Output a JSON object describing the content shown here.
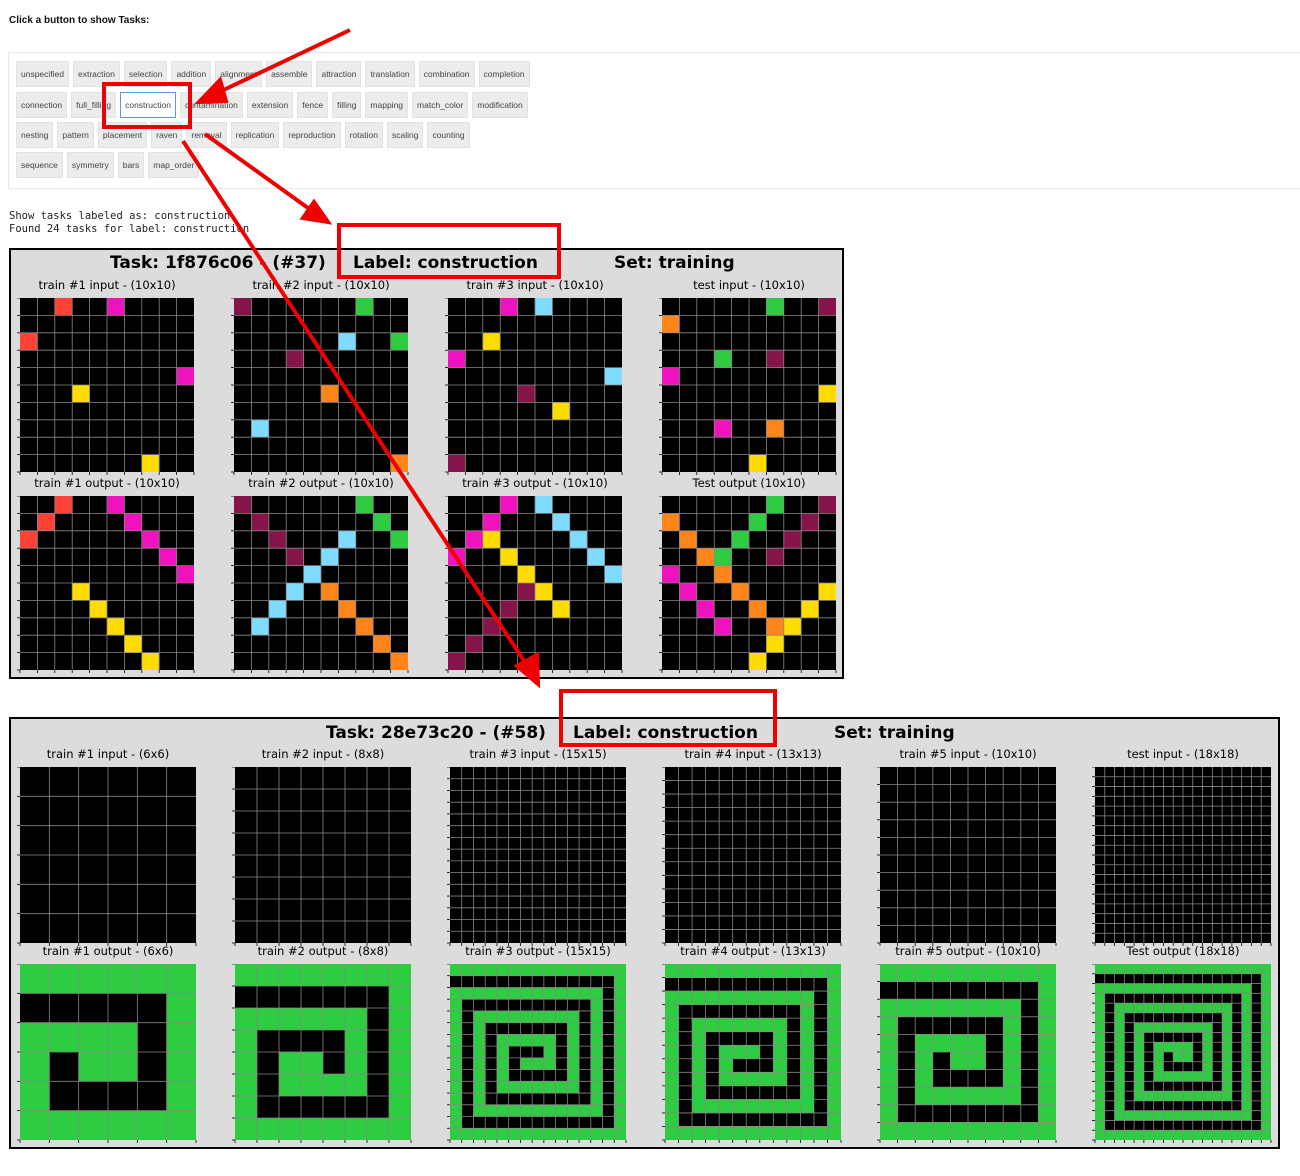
{
  "prompt": "Click a button to show Tasks:",
  "label_buttons": [
    [
      "unspecified",
      "extraction",
      "selection",
      "addition",
      "alignment",
      "assemble",
      "attraction",
      "translation",
      "combination",
      "completion"
    ],
    [
      "connection",
      "full_filling",
      "construction",
      "contamination",
      "extension",
      "fence",
      "filling",
      "mapping",
      "match_color",
      "modification"
    ],
    [
      "nesting",
      "pattern",
      "placement",
      "raven",
      "removal",
      "replication",
      "reproduction",
      "rotation",
      "scaling",
      "counting"
    ],
    [
      "sequence",
      "symmetry",
      "bars",
      "map_order"
    ]
  ],
  "selected_label": "construction",
  "output_lines": [
    "Show tasks labeled as: construction",
    "Found 24 tasks for label: construction"
  ],
  "colors": {
    "black": "#000000",
    "red": "#ff4136",
    "magenta": "#f012be",
    "green": "#2ecc40",
    "yellow": "#ffdc00",
    "orange": "#ff851b",
    "sky": "#7fdbff",
    "maroon": "#85144b",
    "figure_bg": "#dcdcdc",
    "annotation": "#ee0000",
    "grid_line": "#888888"
  },
  "tasks": [
    {
      "title_task": "Task: 1f876c06 - (#37)",
      "title_label": "Label: construction",
      "title_set": "Set: training",
      "panels": [
        {
          "title": "train #1 input  - (10x10)",
          "size": 10,
          "cells": [
            [
              0,
              2,
              "red"
            ],
            [
              0,
              5,
              "magenta"
            ],
            [
              2,
              0,
              "red"
            ],
            [
              4,
              9,
              "magenta"
            ],
            [
              5,
              3,
              "yellow"
            ],
            [
              9,
              7,
              "yellow"
            ]
          ]
        },
        {
          "title": "train #2 input  - (10x10)",
          "size": 10,
          "cells": [
            [
              0,
              0,
              "maroon"
            ],
            [
              0,
              7,
              "green"
            ],
            [
              2,
              6,
              "sky"
            ],
            [
              2,
              9,
              "green"
            ],
            [
              3,
              3,
              "maroon"
            ],
            [
              5,
              5,
              "orange"
            ],
            [
              7,
              1,
              "sky"
            ],
            [
              9,
              9,
              "orange"
            ]
          ]
        },
        {
          "title": "train #3 input  - (10x10)",
          "size": 10,
          "cells": [
            [
              0,
              3,
              "magenta"
            ],
            [
              0,
              5,
              "sky"
            ],
            [
              2,
              2,
              "yellow"
            ],
            [
              3,
              0,
              "magenta"
            ],
            [
              4,
              9,
              "sky"
            ],
            [
              5,
              4,
              "maroon"
            ],
            [
              6,
              6,
              "yellow"
            ],
            [
              9,
              0,
              "maroon"
            ]
          ]
        },
        {
          "title": "test input  - (10x10)",
          "size": 10,
          "cells": [
            [
              0,
              6,
              "green"
            ],
            [
              0,
              9,
              "maroon"
            ],
            [
              1,
              0,
              "orange"
            ],
            [
              3,
              3,
              "green"
            ],
            [
              3,
              6,
              "maroon"
            ],
            [
              4,
              0,
              "magenta"
            ],
            [
              5,
              9,
              "yellow"
            ],
            [
              7,
              3,
              "magenta"
            ],
            [
              7,
              6,
              "orange"
            ],
            [
              9,
              5,
              "yellow"
            ]
          ]
        },
        {
          "title": "train #1 output  - (10x10)",
          "size": 10,
          "cells": [
            [
              0,
              2,
              "red"
            ],
            [
              1,
              1,
              "red"
            ],
            [
              2,
              0,
              "red"
            ],
            [
              0,
              5,
              "magenta"
            ],
            [
              1,
              6,
              "magenta"
            ],
            [
              2,
              7,
              "magenta"
            ],
            [
              3,
              8,
              "magenta"
            ],
            [
              4,
              9,
              "magenta"
            ],
            [
              5,
              3,
              "yellow"
            ],
            [
              6,
              4,
              "yellow"
            ],
            [
              7,
              5,
              "yellow"
            ],
            [
              8,
              6,
              "yellow"
            ],
            [
              9,
              7,
              "yellow"
            ]
          ]
        },
        {
          "title": "train #2 output  - (10x10)",
          "size": 10,
          "cells": [
            [
              0,
              0,
              "maroon"
            ],
            [
              1,
              1,
              "maroon"
            ],
            [
              2,
              2,
              "maroon"
            ],
            [
              3,
              3,
              "maroon"
            ],
            [
              0,
              7,
              "green"
            ],
            [
              1,
              8,
              "green"
            ],
            [
              2,
              9,
              "green"
            ],
            [
              2,
              6,
              "sky"
            ],
            [
              3,
              5,
              "sky"
            ],
            [
              4,
              4,
              "sky"
            ],
            [
              5,
              3,
              "sky"
            ],
            [
              6,
              2,
              "sky"
            ],
            [
              7,
              1,
              "sky"
            ],
            [
              5,
              5,
              "orange"
            ],
            [
              6,
              6,
              "orange"
            ],
            [
              7,
              7,
              "orange"
            ],
            [
              8,
              8,
              "orange"
            ],
            [
              9,
              9,
              "orange"
            ]
          ]
        },
        {
          "title": "train #3 output  - (10x10)",
          "size": 10,
          "cells": [
            [
              0,
              3,
              "magenta"
            ],
            [
              1,
              2,
              "magenta"
            ],
            [
              2,
              1,
              "magenta"
            ],
            [
              3,
              0,
              "magenta"
            ],
            [
              0,
              5,
              "sky"
            ],
            [
              1,
              6,
              "sky"
            ],
            [
              2,
              7,
              "sky"
            ],
            [
              3,
              8,
              "sky"
            ],
            [
              4,
              9,
              "sky"
            ],
            [
              2,
              2,
              "yellow"
            ],
            [
              3,
              3,
              "yellow"
            ],
            [
              4,
              4,
              "yellow"
            ],
            [
              5,
              5,
              "yellow"
            ],
            [
              6,
              6,
              "yellow"
            ],
            [
              5,
              4,
              "maroon"
            ],
            [
              6,
              3,
              "maroon"
            ],
            [
              7,
              2,
              "maroon"
            ],
            [
              8,
              1,
              "maroon"
            ],
            [
              9,
              0,
              "maroon"
            ]
          ]
        },
        {
          "title": "Test output (10x10)",
          "size": 10,
          "cells": [
            [
              0,
              6,
              "green"
            ],
            [
              1,
              5,
              "green"
            ],
            [
              2,
              4,
              "green"
            ],
            [
              3,
              3,
              "green"
            ],
            [
              0,
              9,
              "maroon"
            ],
            [
              1,
              8,
              "maroon"
            ],
            [
              2,
              7,
              "maroon"
            ],
            [
              3,
              6,
              "maroon"
            ],
            [
              1,
              0,
              "orange"
            ],
            [
              2,
              1,
              "orange"
            ],
            [
              3,
              2,
              "orange"
            ],
            [
              4,
              3,
              "orange"
            ],
            [
              5,
              4,
              "orange"
            ],
            [
              6,
              5,
              "orange"
            ],
            [
              7,
              6,
              "orange"
            ],
            [
              4,
              0,
              "magenta"
            ],
            [
              5,
              1,
              "magenta"
            ],
            [
              6,
              2,
              "magenta"
            ],
            [
              7,
              3,
              "magenta"
            ],
            [
              5,
              9,
              "yellow"
            ],
            [
              6,
              8,
              "yellow"
            ],
            [
              7,
              7,
              "yellow"
            ],
            [
              8,
              6,
              "yellow"
            ],
            [
              9,
              5,
              "yellow"
            ]
          ]
        }
      ]
    },
    {
      "title_task": "Task: 28e73c20 - (#58)",
      "title_label": "Label: construction",
      "title_set": "Set: training",
      "panels": [
        {
          "title": "train #1 input  - (6x6)",
          "size": 6
        },
        {
          "title": "train #2 input  - (8x8)",
          "size": 8
        },
        {
          "title": "train #3 input  - (15x15)",
          "size": 15
        },
        {
          "title": "train #4 input  - (13x13)",
          "size": 13
        },
        {
          "title": "train #5 input  - (10x10)",
          "size": 10
        },
        {
          "title": "test input  - (18x18)",
          "size": 18
        },
        {
          "title": "train #1 output  - (6x6)",
          "size": 6,
          "spiral": true
        },
        {
          "title": "train #2 output  - (8x8)",
          "size": 8,
          "spiral": true
        },
        {
          "title": "train #3 output  - (15x15)",
          "size": 15,
          "spiral": true
        },
        {
          "title": "train #4 output  - (13x13)",
          "size": 13,
          "spiral": true
        },
        {
          "title": "train #5 output  - (10x10)",
          "size": 10,
          "spiral": true
        },
        {
          "title": "Test output (18x18)",
          "size": 18,
          "spiral": true
        }
      ]
    }
  ]
}
